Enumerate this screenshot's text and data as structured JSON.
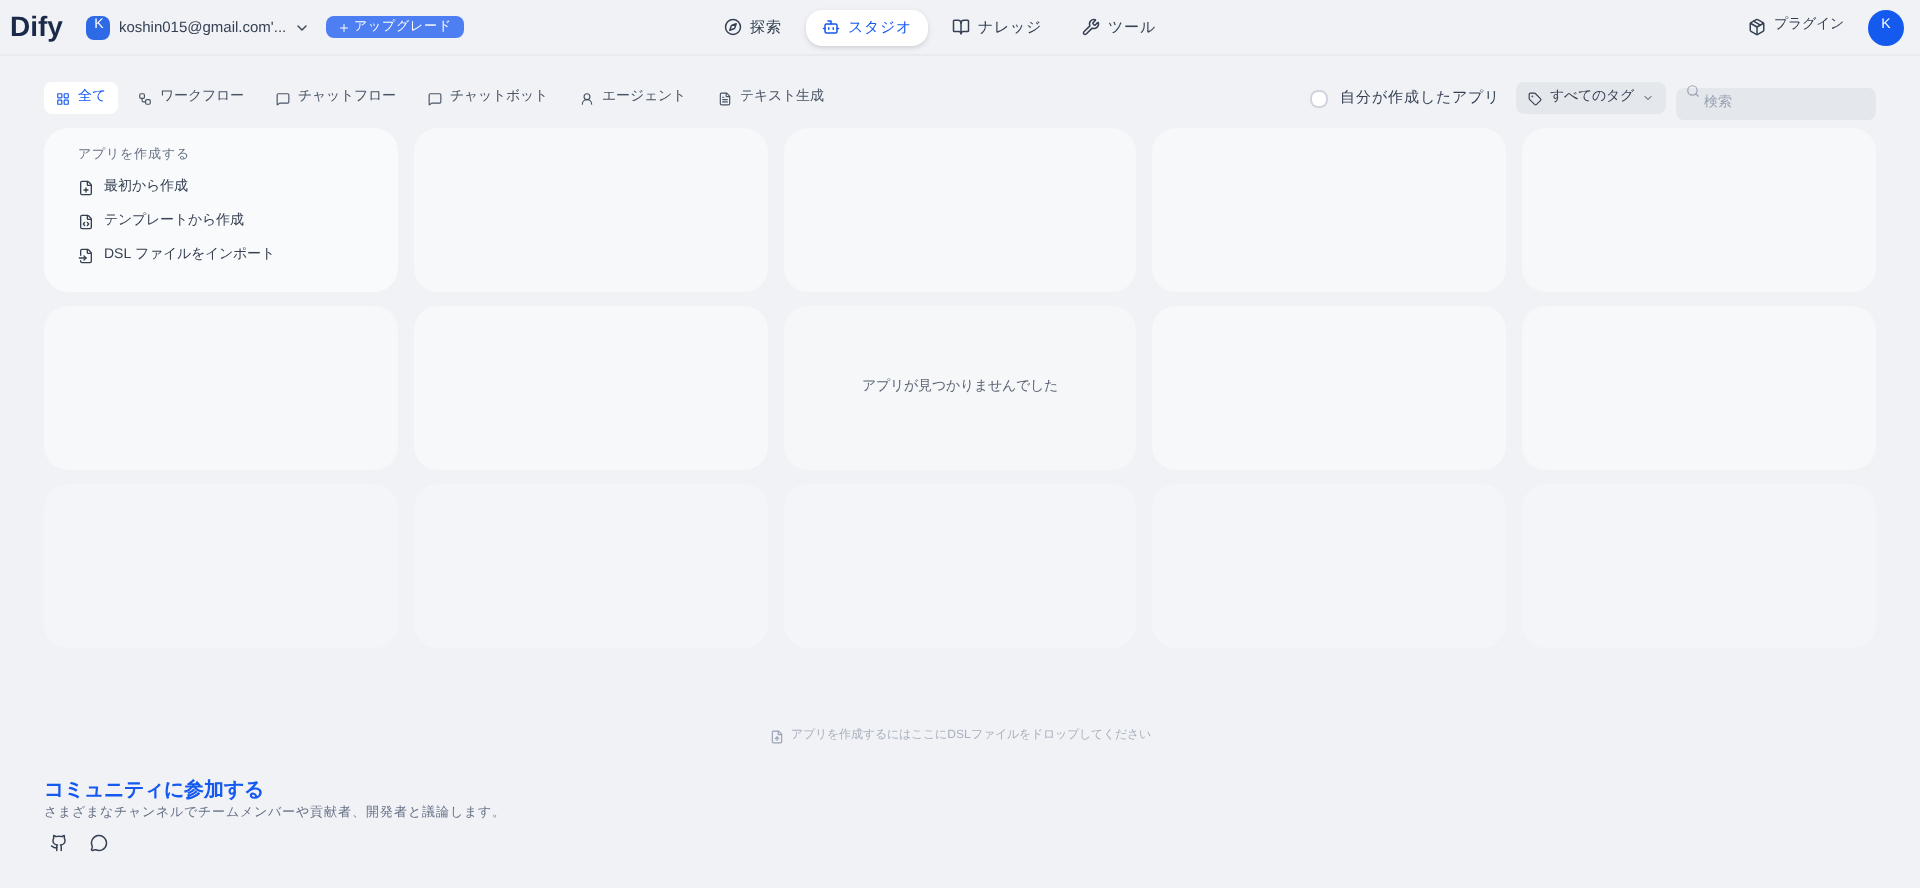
{
  "header": {
    "logo": "Dify",
    "workspace": {
      "initial": "K",
      "name": "koshin015@gmail.com'..."
    },
    "upgrade": "アップグレード",
    "nav": [
      {
        "label": "探索",
        "selected": false
      },
      {
        "label": "スタジオ",
        "selected": true
      },
      {
        "label": "ナレッジ",
        "selected": false
      },
      {
        "label": "ツール",
        "selected": false
      }
    ],
    "plugin": "プラグイン",
    "avatar": "K"
  },
  "filters": [
    {
      "label": "全て",
      "selected": true
    },
    {
      "label": "ワークフロー",
      "selected": false
    },
    {
      "label": "チャットフロー",
      "selected": false
    },
    {
      "label": "チャットボット",
      "selected": false
    },
    {
      "label": "エージェント",
      "selected": false
    },
    {
      "label": "テキスト生成",
      "selected": false
    }
  ],
  "mine": {
    "label": "自分が作成したアプリ",
    "checked": false
  },
  "tags": "すべてのタグ",
  "search": {
    "placeholder": "検索"
  },
  "create": {
    "title": "アプリを作成する",
    "items": [
      {
        "label": "最初から作成"
      },
      {
        "label": "テンプレートから作成"
      },
      {
        "label": "DSL ファイルをインポート"
      }
    ]
  },
  "empty_message": "アプリが見つかりませんでした",
  "drop_hint": "アプリを作成するにはここにDSLファイルをドロップしてください",
  "community": {
    "title": "コミュニティに参加する",
    "text": "さまざまなチャンネルでチームメンバーや貢献者、開発者と議論します。"
  }
}
